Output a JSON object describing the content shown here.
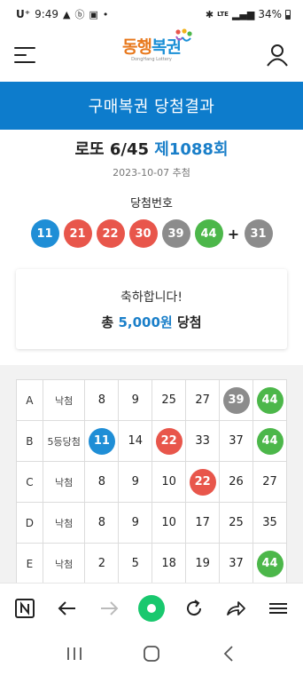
{
  "status_bar": {
    "carrier": "U⁺",
    "time": "9:49",
    "network": "LTE",
    "battery": "34%"
  },
  "header": {
    "logo_text_part1": "동행",
    "logo_text_part2": "복권",
    "logo_sub": "DongHang Lottery"
  },
  "banner": {
    "title": "구매복권 당첨결과"
  },
  "draw": {
    "game": "로또 6/45",
    "round": "제1088회",
    "date": "2023-10-07 추첨",
    "win_label": "당첨번호",
    "numbers": [
      {
        "value": "11",
        "color": "#1f8ed6"
      },
      {
        "value": "21",
        "color": "#e8564b"
      },
      {
        "value": "22",
        "color": "#e8564b"
      },
      {
        "value": "30",
        "color": "#e8564b"
      },
      {
        "value": "39",
        "color": "#8c8c8c"
      },
      {
        "value": "44",
        "color": "#4cb74a"
      }
    ],
    "plus": "+",
    "bonus": {
      "value": "31",
      "color": "#8c8c8c"
    }
  },
  "result_card": {
    "message": "축하합니다!",
    "prize_prefix": "총",
    "prize_amount": "5,000원",
    "prize_suffix": "당첨"
  },
  "picks": [
    {
      "label": "A",
      "result": "낙첨",
      "numbers": [
        {
          "value": "8"
        },
        {
          "value": "9"
        },
        {
          "value": "25"
        },
        {
          "value": "27"
        },
        {
          "value": "39",
          "color": "#8c8c8c"
        },
        {
          "value": "44",
          "color": "#4cb74a"
        }
      ]
    },
    {
      "label": "B",
      "result": "5등당첨",
      "numbers": [
        {
          "value": "11",
          "color": "#1f8ed6"
        },
        {
          "value": "14"
        },
        {
          "value": "22",
          "color": "#e8564b"
        },
        {
          "value": "33"
        },
        {
          "value": "37"
        },
        {
          "value": "44",
          "color": "#4cb74a"
        }
      ]
    },
    {
      "label": "C",
      "result": "낙첨",
      "numbers": [
        {
          "value": "8"
        },
        {
          "value": "9"
        },
        {
          "value": "10"
        },
        {
          "value": "22",
          "color": "#e8564b"
        },
        {
          "value": "26"
        },
        {
          "value": "27"
        }
      ]
    },
    {
      "label": "D",
      "result": "낙첨",
      "numbers": [
        {
          "value": "8"
        },
        {
          "value": "9"
        },
        {
          "value": "10"
        },
        {
          "value": "17"
        },
        {
          "value": "25"
        },
        {
          "value": "35"
        }
      ]
    },
    {
      "label": "E",
      "result": "낙첨",
      "numbers": [
        {
          "value": "2"
        },
        {
          "value": "5"
        },
        {
          "value": "18"
        },
        {
          "value": "19"
        },
        {
          "value": "37"
        },
        {
          "value": "44",
          "color": "#4cb74a"
        }
      ]
    }
  ],
  "browser_toolbar": {
    "icons": [
      "naver-n-icon",
      "back-arrow-icon",
      "forward-arrow-icon",
      "home-circle-icon",
      "refresh-icon",
      "share-icon",
      "menu-icon"
    ],
    "accent": "#19c86e"
  },
  "system_nav": {
    "icons": [
      "recent-apps-icon",
      "home-icon",
      "back-icon"
    ]
  }
}
